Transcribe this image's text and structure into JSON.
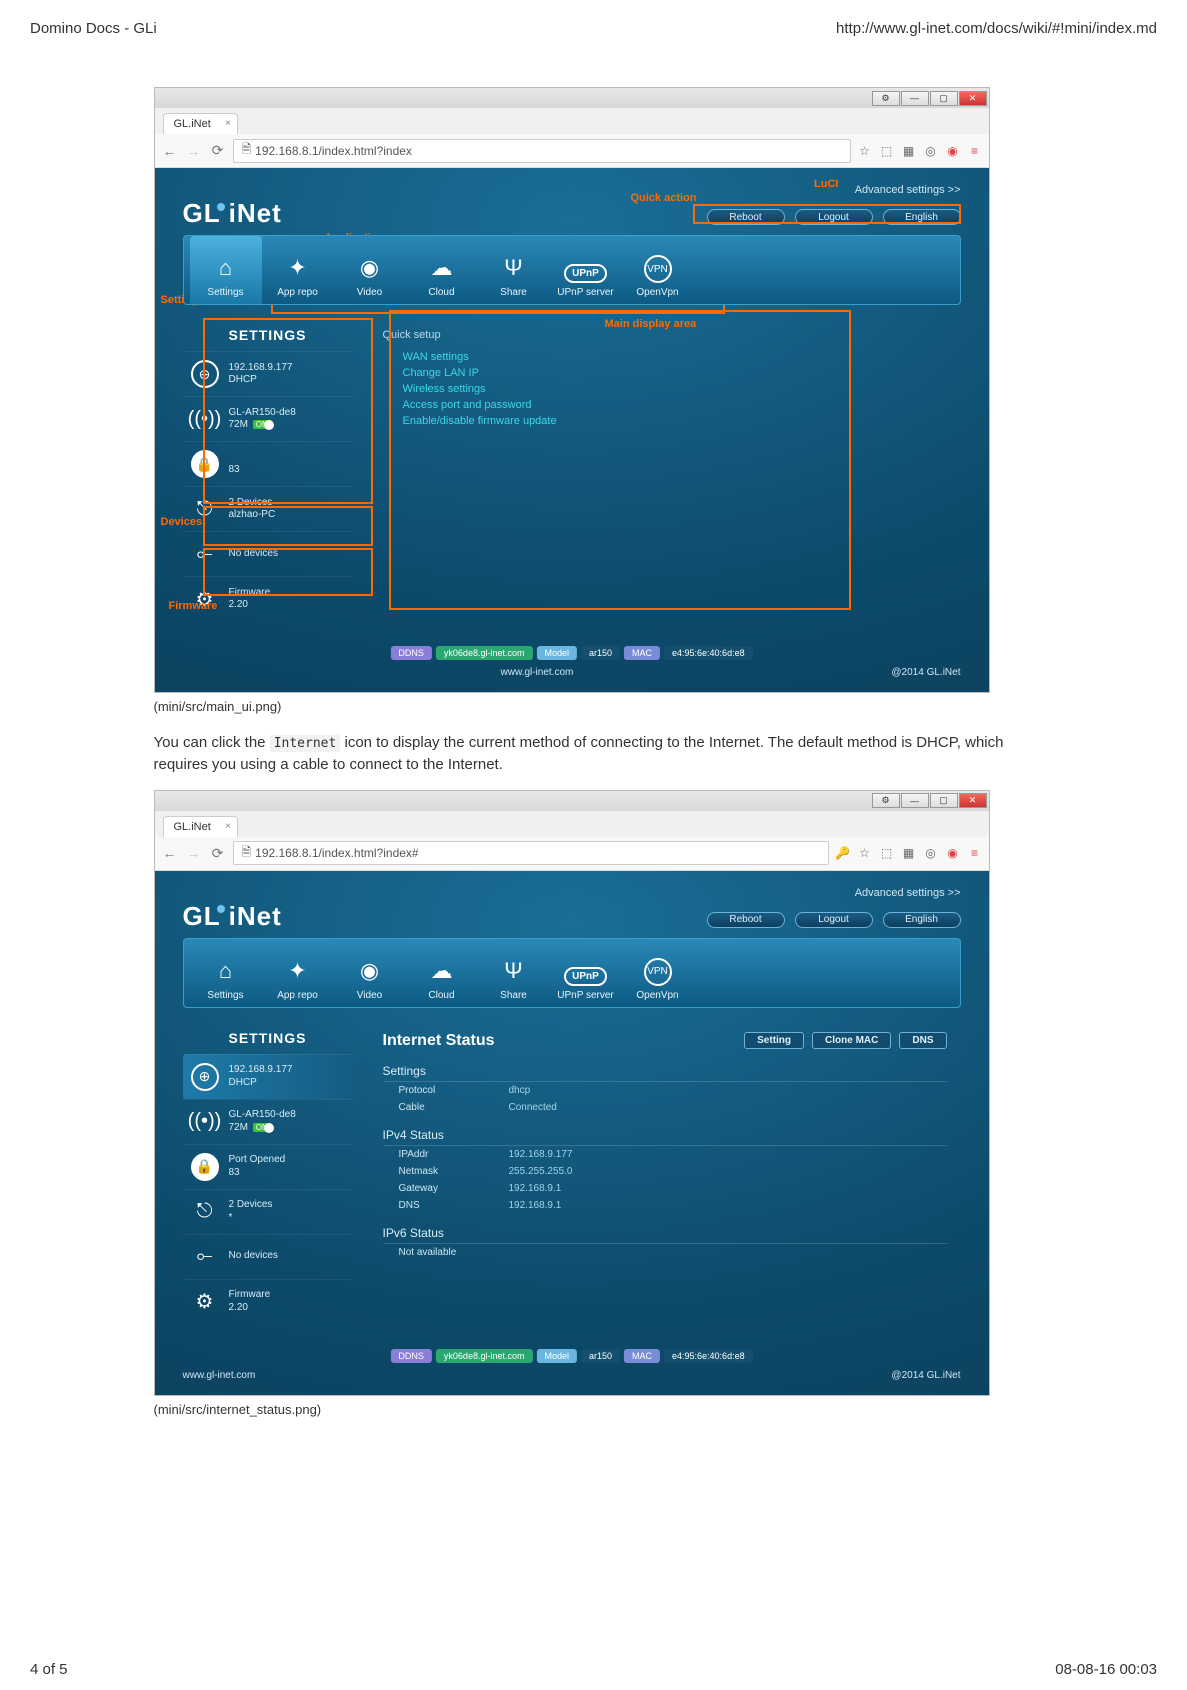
{
  "print": {
    "title_left": "Domino Docs - GLi",
    "title_right": "http://www.gl-inet.com/docs/wiki/#!mini/index.md",
    "footer_left": "4 of 5",
    "footer_right": "08-08-16 00:03"
  },
  "caption1": "(mini/src/main_ui.png)",
  "caption2": "(mini/src/internet_status.png)",
  "paragraph_pre": "You can click the ",
  "paragraph_code": "Internet",
  "paragraph_post": " icon to display the current method of connecting to the Internet. The default method is DHCP, which requires you using a cable to connect to the Internet.",
  "browser": {
    "tab_title": "GL.iNet",
    "url1": "192.168.8.1/index.html?index",
    "url2": "192.168.8.1/index.html?index#"
  },
  "annotations": {
    "luci": "LuCI",
    "quick_action": "Quick action",
    "applications": "Applications",
    "settings": "Settings",
    "devices": "Devices",
    "firmware": "Firmware",
    "main_area": "Main display area"
  },
  "header_buttons": {
    "adv": "Advanced settings >>",
    "reboot": "Reboot",
    "logout": "Logout",
    "lang": "English"
  },
  "logo": "GL·iNet",
  "icons": {
    "settings": "Settings",
    "apprepo": "App repo",
    "video": "Video",
    "cloud": "Cloud",
    "share": "Share",
    "upnp": "UPnP server",
    "upnp_badge": "UPnP",
    "vpn": "OpenVpn",
    "vpn_badge": "VPN"
  },
  "sidebar": {
    "title": "SETTINGS",
    "internet_ip": "192.168.9.177",
    "internet_mode": "DHCP",
    "wifi_name": "GL-AR150-de8",
    "wifi_speed": "72M",
    "on": "ON",
    "port_label1": "Port Opened",
    "port_value1": "83",
    "port_short": "83",
    "clients_count": "2 Devices",
    "clients_name": "alzhao-PC",
    "clients_short": "*",
    "usb": "No devices",
    "fw_label": "Firmware",
    "fw_ver": "2.20"
  },
  "quick": {
    "title": "Quick setup",
    "l1": "WAN settings",
    "l2": "Change LAN IP",
    "l3": "Wireless settings",
    "l4": "Access port and password",
    "l5": "Enable/disable firmware update"
  },
  "footer": {
    "site": "www.gl-inet.com",
    "ddns_l": "DDNS",
    "ddns_v": "yk06de8.gl-inet.com",
    "model_l": "Model",
    "model_v": "ar150",
    "mac_l": "MAC",
    "mac_v": "e4:95:6e:40:6d:e8",
    "copyright": "@2014 GL.iNet"
  },
  "status": {
    "title": "Internet Status",
    "btn1": "Setting",
    "btn2": "Clone MAC",
    "btn3": "DNS",
    "sec_settings": "Settings",
    "protocol_k": "Protocol",
    "protocol_v": "dhcp",
    "cable_k": "Cable",
    "cable_v": "Connected",
    "sec_ipv4": "IPv4 Status",
    "ip_k": "IPAddr",
    "ip_v": "192.168.9.177",
    "mask_k": "Netmask",
    "mask_v": "255.255.255.0",
    "gw_k": "Gateway",
    "gw_v": "192.168.9.1",
    "dns_k": "DNS",
    "dns_v": "192.168.9.1",
    "sec_ipv6": "IPv6 Status",
    "ipv6_v": "Not available"
  }
}
